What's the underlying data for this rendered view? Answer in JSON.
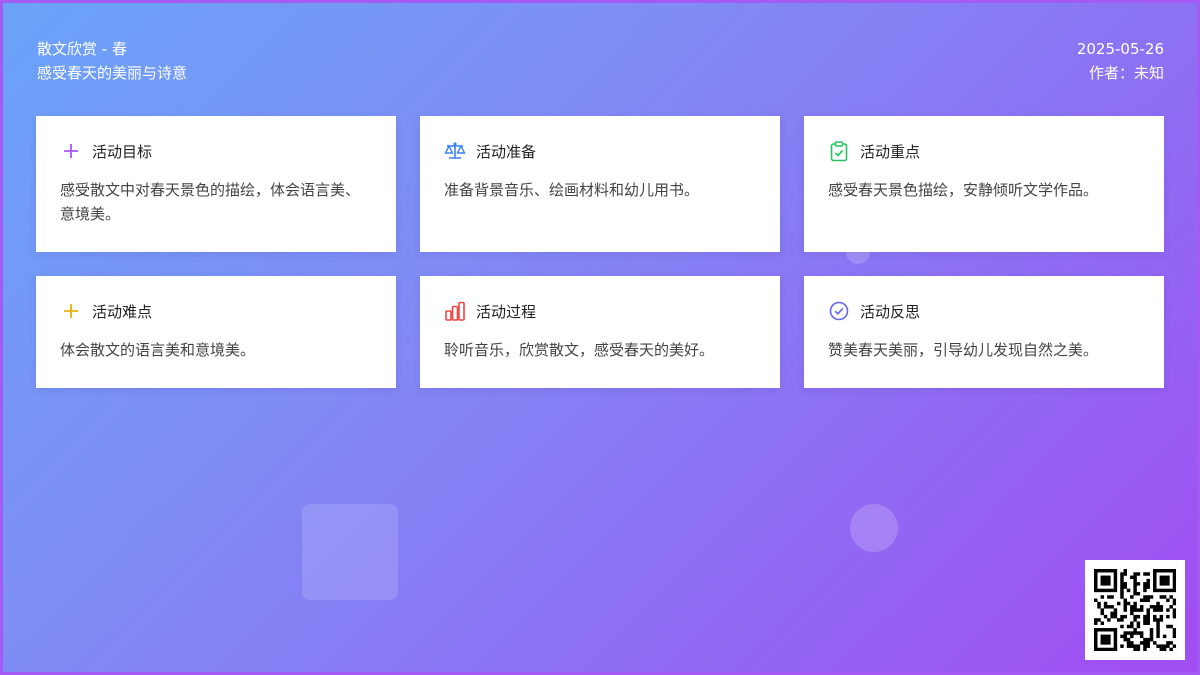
{
  "header": {
    "title": "散文欣赏 - 春",
    "subtitle": "感受春天的美丽与诗意",
    "date": "2025-05-26",
    "author": "作者：未知"
  },
  "cards": [
    {
      "title": "活动目标",
      "text": "感受散文中对春天景色的描绘，体会语言美、意境美。",
      "icon": "plus-icon",
      "color": "#a855f7"
    },
    {
      "title": "活动准备",
      "text": "准备背景音乐、绘画材料和幼儿用书。",
      "icon": "scale-icon",
      "color": "#3b82f6"
    },
    {
      "title": "活动重点",
      "text": "感受春天景色描绘，安静倾听文学作品。",
      "icon": "clipboard-check-icon",
      "color": "#22c55e"
    },
    {
      "title": "活动难点",
      "text": "体会散文的语言美和意境美。",
      "icon": "plus-icon",
      "color": "#eab308"
    },
    {
      "title": "活动过程",
      "text": "聆听音乐，欣赏散文，感受春天的美好。",
      "icon": "bar-chart-icon",
      "color": "#ef4444"
    },
    {
      "title": "活动反思",
      "text": "赞美春天美丽，引导幼儿发现自然之美。",
      "icon": "check-circle-icon",
      "color": "#6366f1"
    }
  ]
}
